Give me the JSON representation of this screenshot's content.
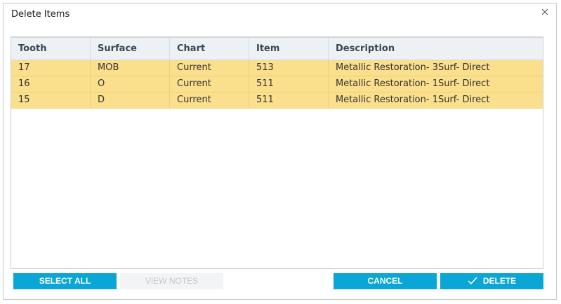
{
  "dialog": {
    "title": "Delete Items"
  },
  "table": {
    "columns": [
      "Tooth",
      "Surface",
      "Chart",
      "Item",
      "Description"
    ],
    "rows": [
      [
        "17",
        "MOB",
        "Current",
        "513",
        "Metallic Restoration- 3Surf- Direct"
      ],
      [
        "16",
        "O",
        "Current",
        "511",
        "Metallic Restoration- 1Surf- Direct"
      ],
      [
        "15",
        "D",
        "Current",
        "511",
        "Metallic Restoration- 1Surf- Direct"
      ]
    ],
    "selected_row_color": "#fadf8c"
  },
  "buttons": {
    "select_all": "SELECT ALL",
    "view_notes": "VIEW NOTES",
    "cancel": "CANCEL",
    "delete": "DELETE"
  },
  "colors": {
    "accent": "#0aa6d6"
  },
  "icons": {
    "close": "close-icon",
    "delete": "check-icon"
  }
}
